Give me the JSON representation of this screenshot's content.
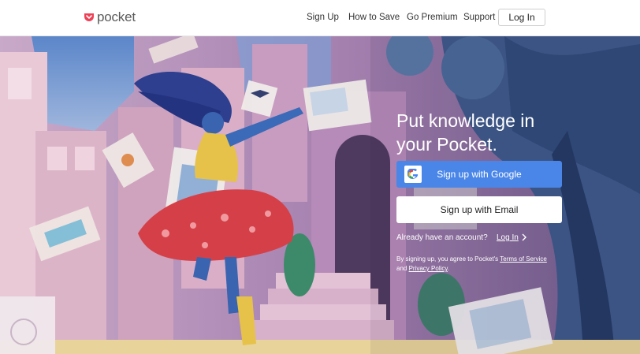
{
  "header": {
    "logo_text": "pocket",
    "nav": {
      "sign_up": "Sign Up",
      "how_to_save": "How to Save",
      "go_premium": "Go Premium",
      "support": "Support"
    },
    "login_button": "Log In"
  },
  "hero": {
    "headline_line1": "Put knowledge in",
    "headline_line2": "your Pocket.",
    "google_button": "Sign up with Google",
    "email_button": "Sign up with Email",
    "already_text": "Already have an account?",
    "login_link": "Log In",
    "legal_prefix": "By signing up, you agree to Pocket's ",
    "terms_link": "Terms of Service",
    "legal_and": "and ",
    "privacy_link": "Privacy Policy",
    "legal_suffix": "."
  },
  "colors": {
    "brand_red": "#ef4056",
    "google_blue": "#4a86e8",
    "hero_overlay": "#8a6a9a"
  },
  "icons": {
    "logo": "pocket-logo-icon",
    "google": "google-g-icon",
    "chevron": "chevron-right-icon"
  }
}
